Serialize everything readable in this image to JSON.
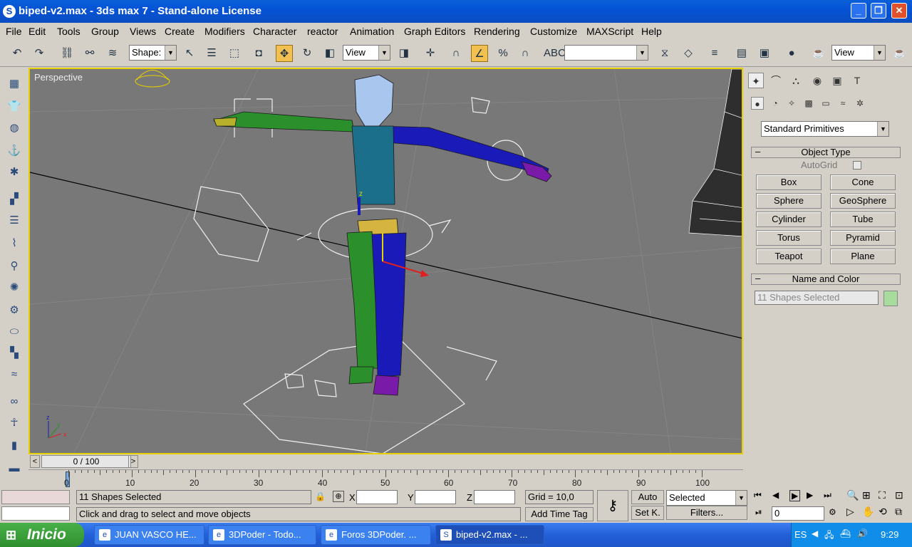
{
  "window": {
    "title": "biped-v2.max - 3ds max 7  - Stand-alone License",
    "app_icon": "3ds-max-icon",
    "controls": [
      "_",
      "❐",
      "✕"
    ]
  },
  "menu": [
    "File",
    "Edit",
    "Tools",
    "Group",
    "Views",
    "Create",
    "Modifiers",
    "Character",
    "reactor",
    "Animation",
    "Graph Editors",
    "Rendering",
    "Customize",
    "MAXScript",
    "Help"
  ],
  "toolbar": {
    "selection_filter": "Shape:",
    "ref_coord_1": "View",
    "named_selection": "",
    "ref_coord_2": "View"
  },
  "viewport": {
    "label": "Perspective",
    "axis_labels": {
      "x": "x",
      "y": "y",
      "z": "z"
    },
    "pivot_label": "z",
    "highlight_color": "#e6d000"
  },
  "command_panel": {
    "category": "Standard Primitives",
    "object_type_title": "Object Type",
    "autogrid_label": "AutoGrid",
    "buttons": [
      "Box",
      "Cone",
      "Sphere",
      "GeoSphere",
      "Cylinder",
      "Tube",
      "Torus",
      "Pyramid",
      "Teapot",
      "Plane"
    ],
    "name_color_title": "Name and Color",
    "name_value": "11 Shapes Selected",
    "swatch_color": "#a6dc9c"
  },
  "timeline": {
    "frame": "0 / 100",
    "prev": "<",
    "next": ">",
    "ticks": [
      "0",
      "10",
      "20",
      "30",
      "40",
      "50",
      "60",
      "70",
      "80",
      "90",
      "100"
    ]
  },
  "status": {
    "selection_info": "11 Shapes Selected",
    "prompt": "Click and drag to select and move objects",
    "x_label": "X",
    "y_label": "Y",
    "z_label": "Z",
    "grid": "Grid = 10,0",
    "add_time_tag": "Add Time Tag",
    "auto": "Auto",
    "set_key": "Set K.",
    "selected_dropdown": "Selected",
    "filters": "Filters...",
    "frame_field": "0"
  },
  "taskbar": {
    "start": "Inicio",
    "tasks": [
      "JUAN VASCO HE...",
      "3DPoder - Todo...",
      "Foros 3DPoder. ...",
      "biped-v2.max - ..."
    ],
    "lang": "ES",
    "time": "9:29"
  }
}
